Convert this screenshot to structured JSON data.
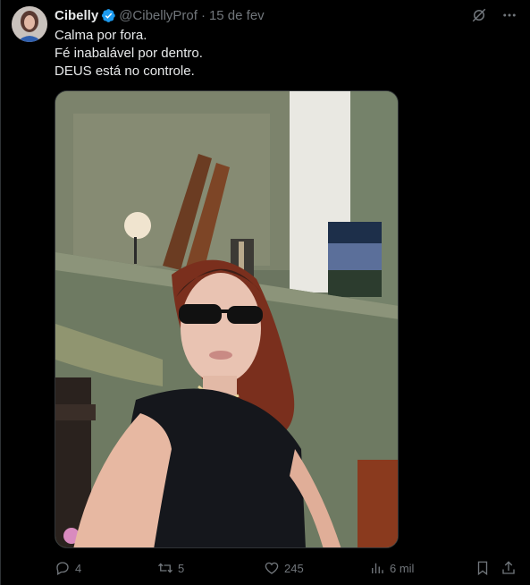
{
  "post": {
    "author_name": "Cibelly",
    "handle": "@CibellyProf",
    "separator": "·",
    "date": "15 de fev",
    "text_lines": [
      "Calma por fora.",
      "Fé inabalável por dentro.",
      "DEUS está no controle."
    ]
  },
  "actions": {
    "replies": "4",
    "reposts": "5",
    "likes": "245",
    "views": "6 mil"
  },
  "colors": {
    "background": "#000000",
    "text": "#e7e9ea",
    "muted": "#71767b",
    "verified": "#1d9bf0"
  },
  "icons": [
    "verified-badge-icon",
    "grok-icon",
    "more-icon",
    "reply-icon",
    "repost-icon",
    "like-icon",
    "views-icon",
    "bookmark-icon",
    "share-icon"
  ]
}
